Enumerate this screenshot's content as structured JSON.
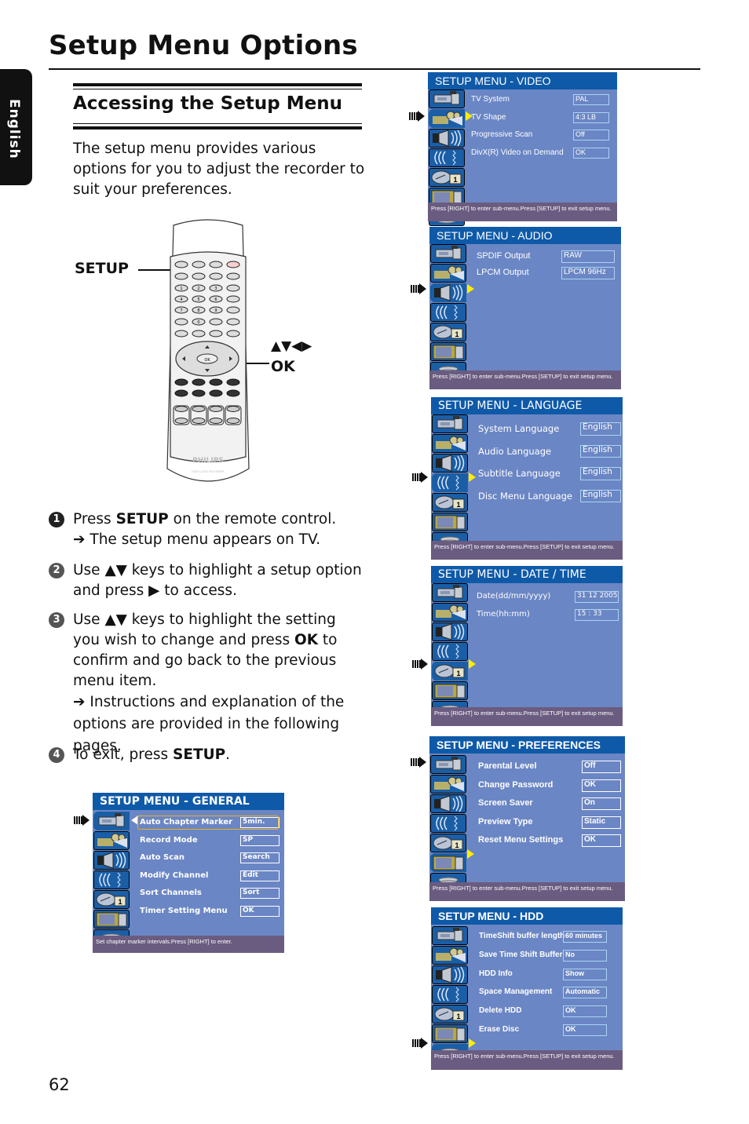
{
  "page": {
    "title": "Setup Menu Options",
    "language_tab": "English",
    "page_number": "62"
  },
  "section": {
    "title": "Accessing the Setup Menu",
    "intro": "The setup menu provides various options for you to adjust the recorder to suit your preferences."
  },
  "remote": {
    "brand": "PHILIPS",
    "model_text": "HDD & DVD RECORDER",
    "callout_setup": "SETUP",
    "callout_nav": "▲▼◀▶",
    "callout_ok": "OK",
    "ok_key": "OK",
    "digit_keys": [
      "1",
      "2",
      "3",
      "4",
      "5",
      "6",
      "7",
      "8",
      "9",
      "0"
    ]
  },
  "steps": [
    {
      "num": "1",
      "pre": "Press ",
      "bold": "SETUP",
      "post": " on the remote control.",
      "note": "The setup menu appears on TV."
    },
    {
      "num": "2",
      "text": "Use ▲▼ keys to highlight a setup option and press ▶ to access."
    },
    {
      "num": "3",
      "pre": "Use ▲▼ keys to highlight the setting you wish to change and press ",
      "bold": "OK",
      "post": " to confirm and go back to the previous menu item.",
      "note": "Instructions and explanation of the options are provided in the following pages."
    },
    {
      "num": "4",
      "pre": "To exit, press ",
      "bold": "SETUP",
      "post": "."
    }
  ],
  "arrow_glyph": "➔",
  "menus": {
    "general": {
      "title": "SETUP MENU - GENERAL",
      "items": [
        {
          "label": "Auto Chapter Marker",
          "value": "5min."
        },
        {
          "label": "Record Mode",
          "value": "SP"
        },
        {
          "label": "Auto Scan",
          "value": "Search"
        },
        {
          "label": "Modify Channel",
          "value": "Edit"
        },
        {
          "label": "Sort Channels",
          "value": "Sort"
        },
        {
          "label": "Timer Setting Menu",
          "value": "OK"
        }
      ],
      "footer": "Set chapter marker intervals.Press [RIGHT] to enter."
    },
    "video": {
      "title": "SETUP MENU - VIDEO",
      "items": [
        {
          "label": "TV System",
          "value": "PAL"
        },
        {
          "label": "TV Shape",
          "value": "4:3 LB"
        },
        {
          "label": "Progressive Scan",
          "value": "Off"
        },
        {
          "label": "DivX(R) Video on Demand",
          "value": "OK"
        }
      ],
      "footer": "Press [RIGHT] to enter sub-menu.Press [SETUP] to exit setup menu."
    },
    "audio": {
      "title": "SETUP MENU - AUDIO",
      "items": [
        {
          "label": "SPDIF Output",
          "value": "RAW"
        },
        {
          "label": "LPCM Output",
          "value": "LPCM 96Hz"
        }
      ],
      "footer": "Press [RIGHT] to enter sub-menu.Press [SETUP] to exit setup menu."
    },
    "language": {
      "title": "SETUP MENU  -  LANGUAGE",
      "items": [
        {
          "label": "System Language",
          "value": "English"
        },
        {
          "label": "Audio Language",
          "value": "English"
        },
        {
          "label": "Subtitle Language",
          "value": "English"
        },
        {
          "label": "Disc Menu Language",
          "value": "English"
        }
      ],
      "footer": "Press [RIGHT] to enter sub-menu.Press [SETUP] to exit setup menu."
    },
    "datetime": {
      "title": "SETUP MENU  -  DATE  /  TIME",
      "items": [
        {
          "label": "Date(dd/mm/yyyy)",
          "value": "31 12  2005"
        },
        {
          "label": "Time(hh:mm)",
          "value": "15  :  33"
        }
      ],
      "footer": "Press [RIGHT] to enter sub-menu.Press [SETUP] to exit setup menu."
    },
    "preferences": {
      "title": "SETUP MENU - PREFERENCES",
      "items": [
        {
          "label": "Parental Level",
          "value": "Off"
        },
        {
          "label": "Change Password",
          "value": "OK"
        },
        {
          "label": "Screen Saver",
          "value": "On"
        },
        {
          "label": "Preview Type",
          "value": "Static"
        },
        {
          "label": "Reset Menu Settings",
          "value": "OK"
        }
      ],
      "footer": "Press [RIGHT] to enter sub-menu.Press [SETUP] to exit setup menu."
    },
    "hdd": {
      "title": "SETUP MENU - HDD",
      "items": [
        {
          "label": "TimeShift buffer length",
          "value": "60 minutes"
        },
        {
          "label": "Save Time Shift Buffer",
          "value": "No"
        },
        {
          "label": "HDD Info",
          "value": "Show"
        },
        {
          "label": "Space Management",
          "value": "Automatic"
        },
        {
          "label": "Delete HDD",
          "value": "OK"
        },
        {
          "label": "Erase Disc",
          "value": "OK"
        }
      ],
      "footer": "Press [RIGHT] to enter sub-menu.Press [SETUP] to exit setup menu."
    }
  },
  "menu_icons": [
    "general-camcorder-icon",
    "video-projector-icon",
    "audio-speaker-icon",
    "language-waves-icon",
    "date-clock-icon",
    "preferences-tv-icon",
    "hdd-disk-icon"
  ],
  "colors": {
    "menu_header": "#0f5aa8",
    "menu_body": "#6b86c4",
    "menu_footer": "#6a5c80",
    "value_border": "#a9d5f4",
    "selection_arrow": "#ffee00"
  }
}
